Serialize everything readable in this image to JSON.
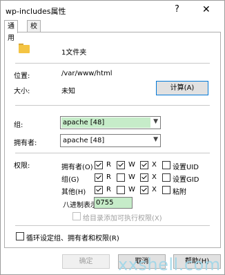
{
  "window": {
    "title": "wp-includes属性",
    "help_glyph": "?",
    "close_glyph": "✕"
  },
  "tabs": [
    {
      "label": "通用"
    },
    {
      "label": "校验码"
    }
  ],
  "general": {
    "name": "1文件夹",
    "location_label": "位置:",
    "location_value": "/var/www/html",
    "size_label": "大小:",
    "size_value": "未知",
    "calculate_button": "计算(A)",
    "group_label": "组:",
    "group_value": "apache [48]",
    "owner_label": "拥有者:",
    "owner_value": "apache [48]",
    "permissions_label": "权限:",
    "rows": [
      {
        "label": "拥有者(O)",
        "r": true,
        "w": true,
        "x": true,
        "special": "设置UID",
        "special_checked": false
      },
      {
        "label": "组(G)",
        "r": true,
        "w": false,
        "x": true,
        "special": "设置GID",
        "special_checked": false
      },
      {
        "label": "其他(H)",
        "r": true,
        "w": false,
        "x": true,
        "special": "粘附",
        "special_checked": false
      }
    ],
    "rwx_labels": {
      "r": "R",
      "w": "W",
      "x": "X"
    },
    "octal_label": "八进制表示",
    "octal_value": "0755",
    "exec_only_label": "给目录添加可执行权限(X)",
    "recursive_label": "循环设定组、拥有者和权限(R)"
  },
  "buttons": {
    "ok": "确定",
    "cancel": "取消",
    "help": "帮助(H)"
  },
  "watermark": "xxshell.com",
  "colors": {
    "field_highlight": "#c6ecc9",
    "focus_border": "#0078d7",
    "watermark": "#9fd6e8"
  },
  "icons": {
    "folder": "folder-icon",
    "combo": "chevron-down-icon"
  }
}
